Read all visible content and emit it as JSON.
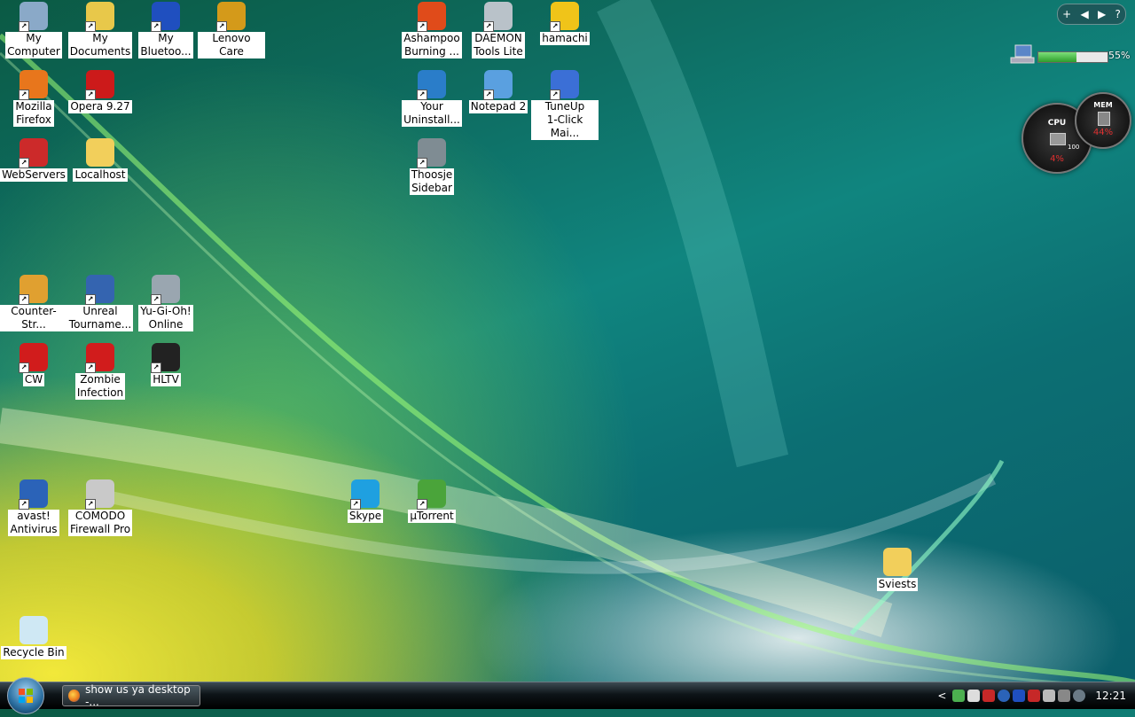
{
  "desktop": {
    "icons": [
      {
        "label": "My\nComputer",
        "icon": "computer-icon",
        "color": "#8aa9c8"
      },
      {
        "label": "My\nDocuments",
        "icon": "documents-folder-icon",
        "color": "#e8c84a"
      },
      {
        "label": "My\nBluetoo...",
        "icon": "bluetooth-icon",
        "color": "#1f4fbf"
      },
      {
        "label": "Lenovo Care",
        "icon": "lenovo-care-icon",
        "color": "#d49a1a"
      },
      {
        "label": "Ashampoo\nBurning ...",
        "icon": "ashampoo-icon",
        "color": "#e04b1a"
      },
      {
        "label": "DAEMON\nTools Lite",
        "icon": "daemon-tools-icon",
        "color": "#b9c2c9"
      },
      {
        "label": "hamachi",
        "icon": "hamachi-icon",
        "color": "#f0c419"
      },
      {
        "label": "Mozilla\nFirefox",
        "icon": "firefox-icon",
        "color": "#e8761c"
      },
      {
        "label": "Opera 9.27",
        "icon": "opera-icon",
        "color": "#cc1a1a"
      },
      {
        "label": "Your\nUninstall...",
        "icon": "uninstaller-icon",
        "color": "#2a7dc9"
      },
      {
        "label": "Notepad 2",
        "icon": "notepad-icon",
        "color": "#5aa0e0"
      },
      {
        "label": "TuneUp\n1-Click Mai...",
        "icon": "tuneup-icon",
        "color": "#3b6fd6"
      },
      {
        "label": "WebServers",
        "icon": "webservers-icon",
        "color": "#cc2a2a"
      },
      {
        "label": "Localhost",
        "icon": "folder-icon",
        "color": "#f2cf5b"
      },
      {
        "label": "Thoosje\nSidebar",
        "icon": "gear-icon",
        "color": "#7f8c93"
      },
      {
        "label": "Counter-Str...",
        "icon": "counter-strike-icon",
        "color": "#e0a030"
      },
      {
        "label": "Unreal\nTourname...",
        "icon": "unreal-tournament-icon",
        "color": "#3464b0"
      },
      {
        "label": "Yu-Gi-Oh!\nOnline",
        "icon": "yugioh-icon",
        "color": "#9aa6b0"
      },
      {
        "label": "CW",
        "icon": "half-life-icon",
        "color": "#d11c1c"
      },
      {
        "label": "Zombie\nInfection",
        "icon": "half-life-icon",
        "color": "#d11c1c"
      },
      {
        "label": "HLTV",
        "icon": "hltv-icon",
        "color": "#222222"
      },
      {
        "label": "avast!\nAntivirus",
        "icon": "avast-icon",
        "color": "#2b63b8"
      },
      {
        "label": "COMODO\nFirewall Pro",
        "icon": "comodo-icon",
        "color": "#c9c9c9"
      },
      {
        "label": "Skype",
        "icon": "skype-icon",
        "color": "#1fa0e0"
      },
      {
        "label": "µTorrent",
        "icon": "utorrent-icon",
        "color": "#4aa43a"
      },
      {
        "label": "Sviests",
        "icon": "folder-icon",
        "color": "#f2cf5b"
      },
      {
        "label": "Recycle Bin",
        "icon": "recycle-bin-icon",
        "color": "#cfe8f4"
      }
    ]
  },
  "sidebar": {
    "toolbar": {
      "add": "+",
      "prev": "◀",
      "next": "▶",
      "help": "?"
    },
    "battery": {
      "percent_text": "55%",
      "level": 0.55
    },
    "cpu_gauge": {
      "label": "CPU",
      "value_text": "4%",
      "scale_max": "100"
    },
    "mem_gauge": {
      "label": "MEM",
      "value_text": "44%"
    }
  },
  "taskbar": {
    "task_button": "show us ya desktop -...",
    "tray_expand": "<",
    "clock": "12:21"
  }
}
